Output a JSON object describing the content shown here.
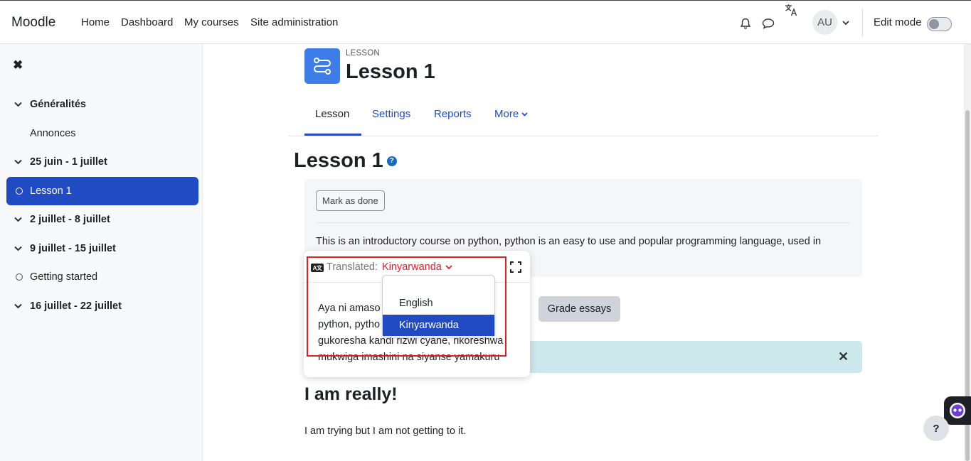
{
  "navbar": {
    "brand": "Moodle",
    "links": [
      "Home",
      "Dashboard",
      "My courses",
      "Site administration"
    ],
    "avatar_initials": "AU",
    "edit_mode_label": "Edit mode"
  },
  "sidebar": {
    "items": [
      {
        "label": "Généralités",
        "type": "section"
      },
      {
        "label": "Annonces",
        "type": "child"
      },
      {
        "label": "25 juin - 1 juillet",
        "type": "section"
      },
      {
        "label": "Lesson 1",
        "type": "activity",
        "active": true
      },
      {
        "label": "2 juillet - 8 juillet",
        "type": "section"
      },
      {
        "label": "9 juillet - 15 juillet",
        "type": "section"
      },
      {
        "label": "Getting started",
        "type": "activity"
      },
      {
        "label": "16 juillet - 22 juillet",
        "type": "section"
      }
    ]
  },
  "header": {
    "kicker": "LESSON",
    "title": "Lesson 1"
  },
  "tabs": [
    {
      "label": "Lesson"
    },
    {
      "label": "Settings"
    },
    {
      "label": "Reports"
    },
    {
      "label": "More"
    }
  ],
  "content": {
    "heading": "Lesson 1",
    "help_glyph": "?",
    "mark_done_label": "Mark as done",
    "intro_text": "This is an introductory course on python, python is an easy to use and popular  programming language, used in",
    "grade_essays_label": "Grade essays",
    "subheading": "I am really!",
    "paragraph": "I am trying but I am not getting to it."
  },
  "translation_popup": {
    "label": "Translated:",
    "selected_language": "Kinyarwanda",
    "icon_text": "A文",
    "lines": [
      "Aya ni amaso",
      "python, pytho",
      "gukoresha kandi rizwi cyane, rikoreshwa",
      "mukwiga imashini na siyanse yamakuru"
    ],
    "options": [
      "English",
      "Kinyarwanda"
    ]
  },
  "help_fab": "?",
  "colors": {
    "primary": "#214bc2",
    "lesson_icon": "#3d7de8",
    "translation_accent": "#d9232d",
    "alert_bg": "#cce8ec"
  }
}
